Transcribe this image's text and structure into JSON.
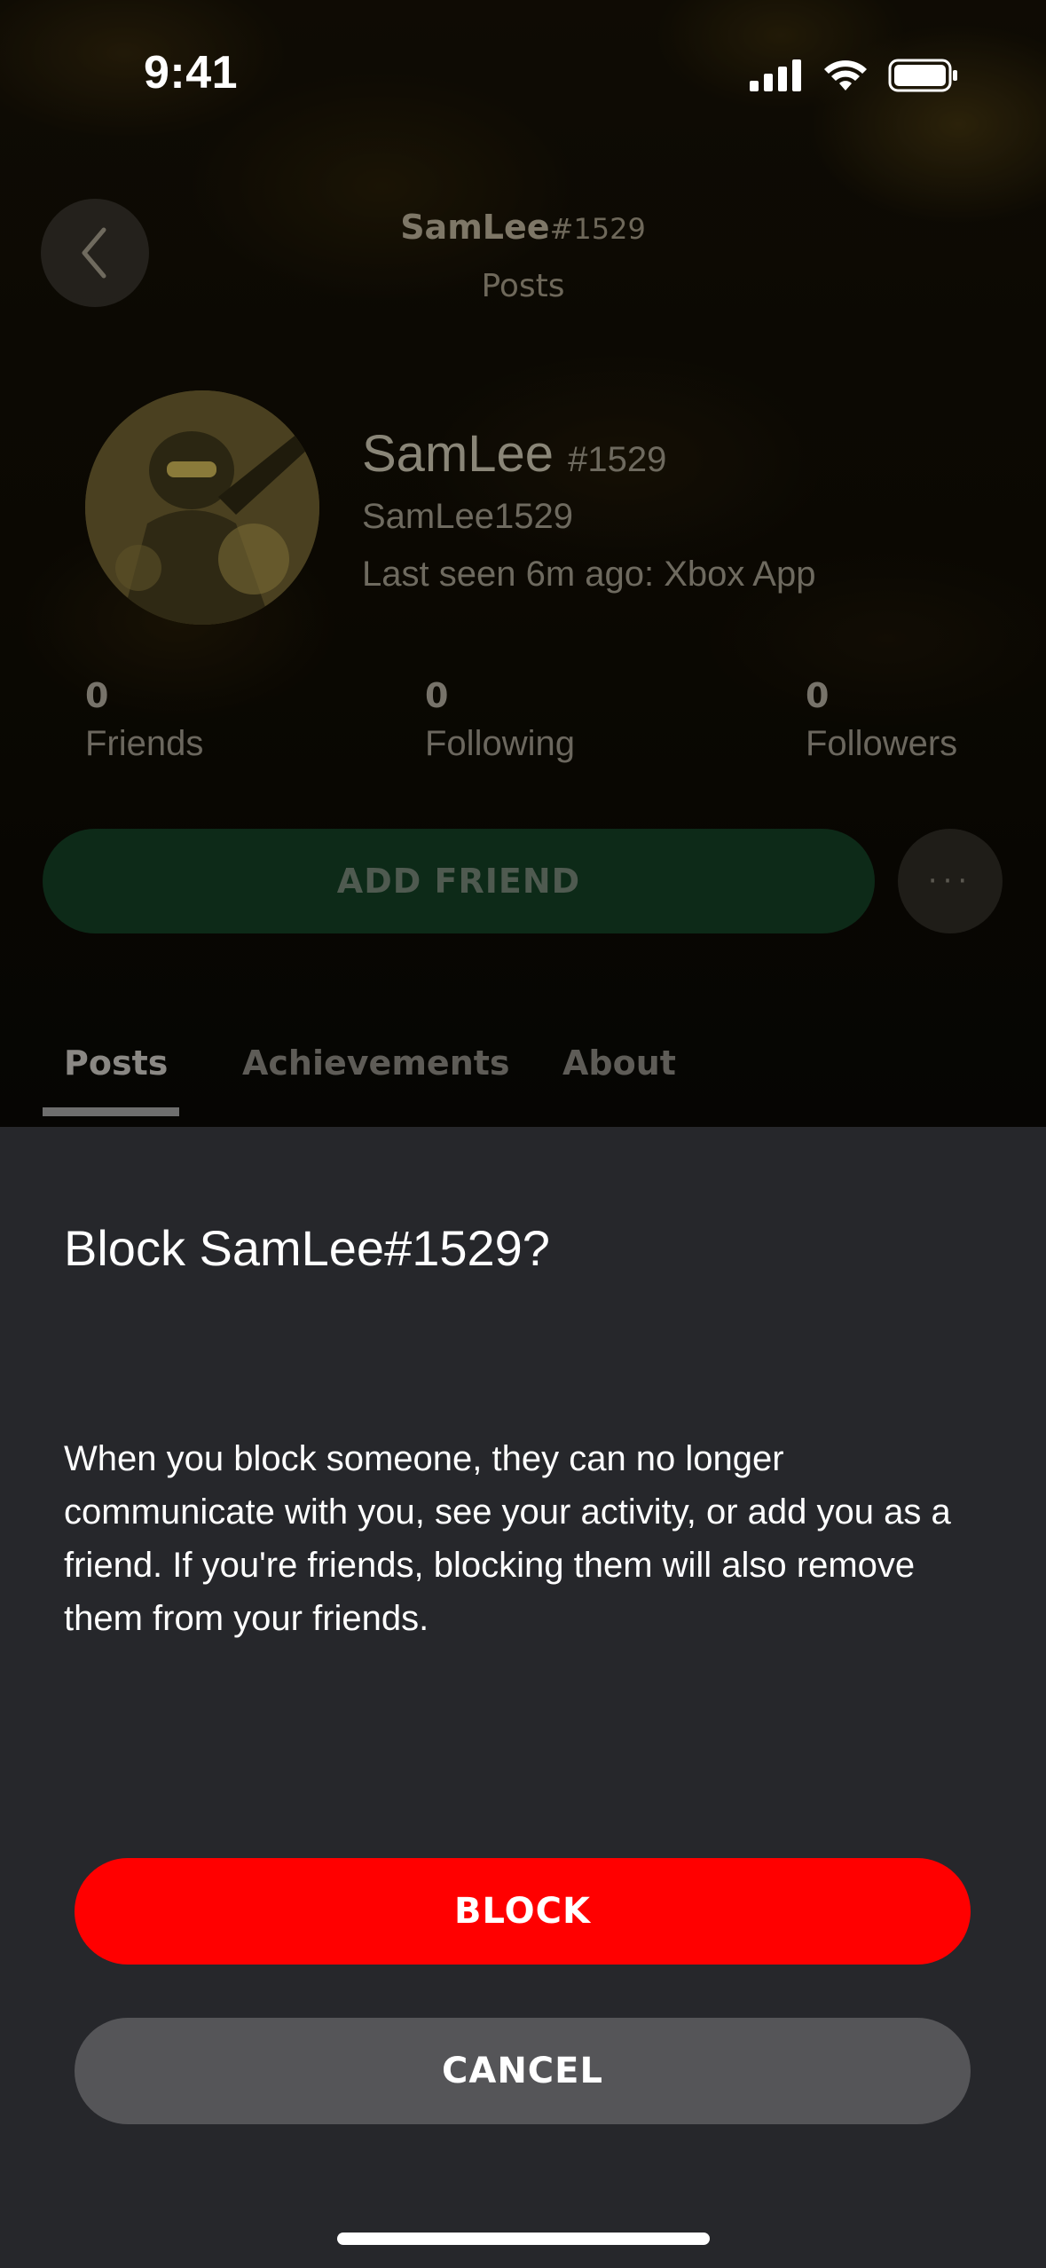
{
  "status_bar": {
    "time": "9:41",
    "icons": [
      "signal-icon",
      "wifi-icon",
      "battery-icon"
    ]
  },
  "header": {
    "gamertag": "SamLee",
    "suffix": "#1529",
    "subtitle": "Posts"
  },
  "profile": {
    "name": "SamLee",
    "suffix": "#1529",
    "gamertag": "SamLee1529",
    "last_seen": "Last seen 6m ago: Xbox App"
  },
  "stats": {
    "friends": {
      "count": "0",
      "label": "Friends"
    },
    "following": {
      "count": "0",
      "label": "Following"
    },
    "followers": {
      "count": "0",
      "label": "Followers"
    }
  },
  "actions": {
    "add_friend": "ADD FRIEND",
    "more": "···"
  },
  "tabs": [
    {
      "label": "Posts",
      "active": true
    },
    {
      "label": "Achievements",
      "active": false
    },
    {
      "label": "About",
      "active": false
    }
  ],
  "dialog": {
    "title": "Block SamLee#1529?",
    "body": "When you block someone, they can no longer communicate with you, see your activity, or add you as a friend. If you're friends, blocking them will also remove them from your friends.",
    "confirm_label": "BLOCK",
    "cancel_label": "CANCEL"
  },
  "colors": {
    "block": "#ff0000",
    "cancel": "#555558",
    "sheet": "#26272b",
    "add_friend": "#0d2a18"
  }
}
